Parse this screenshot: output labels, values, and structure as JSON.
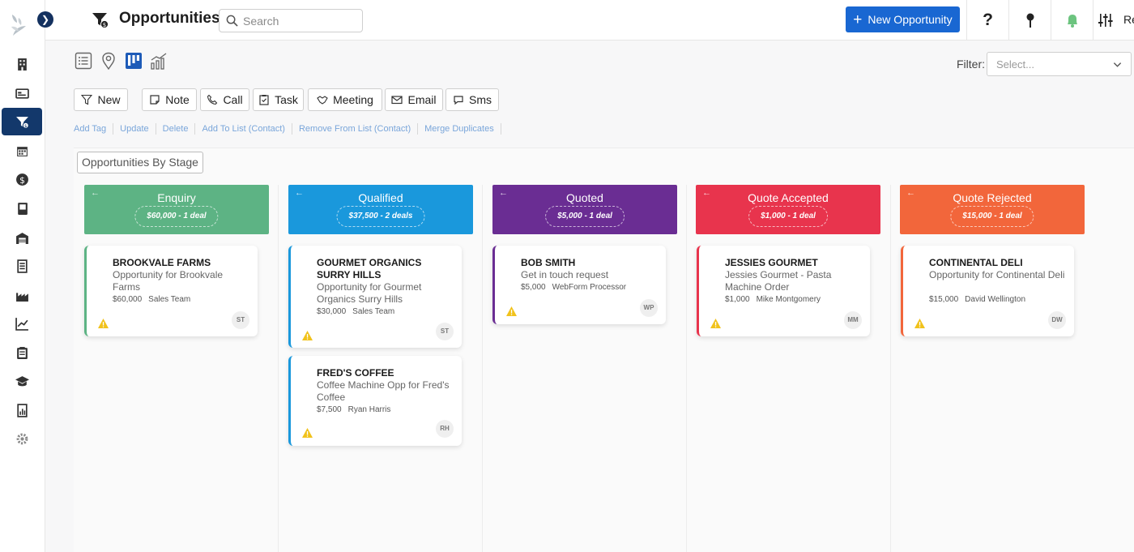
{
  "app": {
    "title": "Opportunities",
    "search_placeholder": "Search",
    "new_button": "New Opportunity",
    "top_right_label": "Re"
  },
  "icons": {
    "sidebar": [
      "building-icon",
      "contact-card-icon",
      "opportunities-funnel-icon",
      "calendar-icon",
      "dollar-icon",
      "book-icon",
      "warehouse-icon",
      "document-list-icon",
      "factory-icon",
      "trend-chart-icon",
      "clipboard-icon",
      "graduation-cap-icon",
      "report-icon",
      "settings-gear-icon"
    ]
  },
  "filter": {
    "label": "Filter:",
    "placeholder": "Select..."
  },
  "actions": [
    "New",
    "Note",
    "Call",
    "Task",
    "Meeting",
    "Email",
    "Sms"
  ],
  "links": [
    "Add Tag",
    "Update",
    "Delete",
    "Add To List (Contact)",
    "Remove From List (Contact)",
    "Merge Duplicates"
  ],
  "board_label": "Opportunities By Stage",
  "columns": [
    {
      "name": "Enquiry",
      "summary": "$60,000 - 1 deal",
      "color": "#5db384",
      "cards": [
        {
          "title": "BROOKVALE FARMS",
          "description": "Opportunity for Brookvale Farms",
          "amount": "$60,000",
          "owner": "Sales Team",
          "initials": "ST"
        }
      ]
    },
    {
      "name": "Qualified",
      "summary": "$37,500 - 2 deals",
      "color": "#1a98dc",
      "cards": [
        {
          "title": "GOURMET ORGANICS SURRY HILLS",
          "description": "Opportunity for Gourmet Organics Surry Hills",
          "amount": "$30,000",
          "owner": "Sales Team",
          "initials": "ST"
        },
        {
          "title": "FRED'S COFFEE",
          "description": "Coffee Machine Opp for Fred's Coffee",
          "amount": "$7,500",
          "owner": "Ryan Harris",
          "initials": "RH"
        }
      ]
    },
    {
      "name": "Quoted",
      "summary": "$5,000 - 1 deal",
      "color": "#6a2d93",
      "cards": [
        {
          "title": "BOB SMITH",
          "description": "Get in touch request",
          "amount": "$5,000",
          "owner": "WebForm Processor",
          "initials": "WP"
        }
      ]
    },
    {
      "name": "Quote Accepted",
      "summary": "$1,000 - 1 deal",
      "color": "#e8344d",
      "cards": [
        {
          "title": "JESSIES GOURMET",
          "description": "Jessies Gourmet - Pasta Machine Order",
          "amount": "$1,000",
          "owner": "Mike Montgomery",
          "initials": "MM"
        }
      ]
    },
    {
      "name": "Quote Rejected",
      "summary": "$15,000 - 1 deal",
      "color": "#f2663b",
      "cards": [
        {
          "title": "CONTINENTAL DELI",
          "description": "Opportunity for Continental Deli",
          "amount": "$15,000",
          "owner": "David Wellington",
          "initials": "DW"
        }
      ]
    }
  ]
}
